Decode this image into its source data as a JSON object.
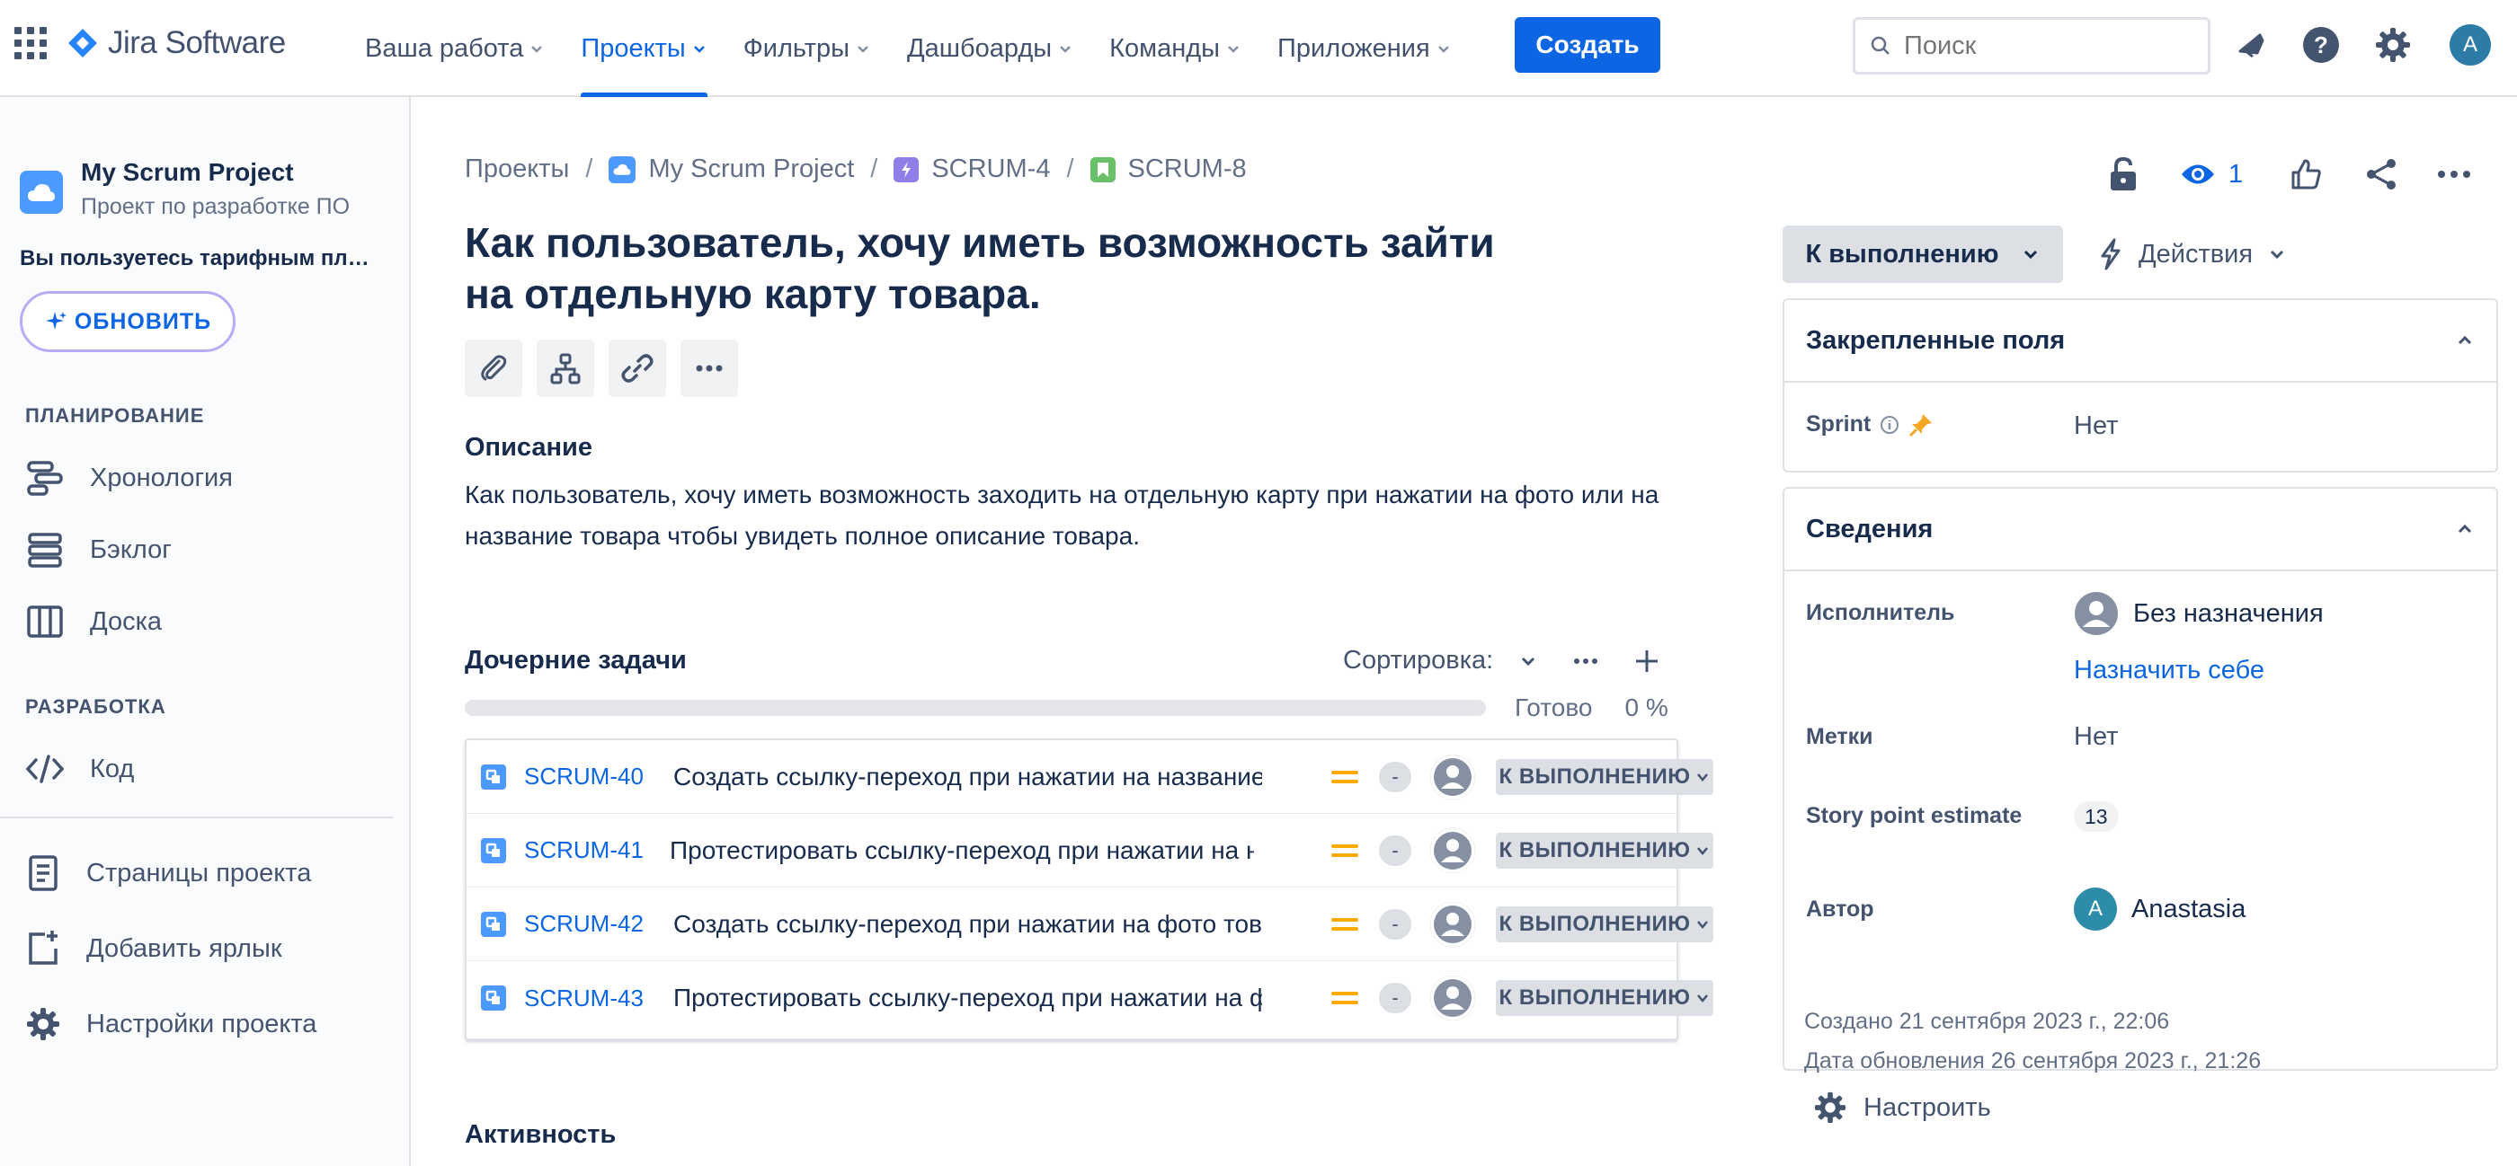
{
  "topbar": {
    "logo_text": "Jira Software",
    "nav": [
      {
        "label": "Ваша работа"
      },
      {
        "label": "Проекты"
      },
      {
        "label": "Фильтры"
      },
      {
        "label": "Дашбоарды"
      },
      {
        "label": "Команды"
      },
      {
        "label": "Приложения"
      }
    ],
    "create_label": "Создать",
    "search_placeholder": "Поиск",
    "avatar_initial": "A",
    "accent": "#0c66e4"
  },
  "sidebar": {
    "project_name": "My Scrum Project",
    "project_type": "Проект по разработке ПО",
    "plan_notice": "Вы пользуетесь тарифным планом Free",
    "upgrade_label": "ОБНОВИТЬ",
    "planning_header": "ПЛАНИРОВАНИЕ",
    "planning_items": [
      "Хронология",
      "Бэклог",
      "Доска"
    ],
    "dev_header": "РАЗРАБОТКА",
    "dev_items": [
      "Код"
    ],
    "footer_items": [
      "Страницы проекта",
      "Добавить ярлык",
      "Настройки проекта"
    ]
  },
  "breadcrumb": {
    "root": "Проекты",
    "project": "My Scrum Project",
    "epic": "SCRUM-4",
    "issue": "SCRUM-8",
    "sep": "/"
  },
  "issue": {
    "title": "Как пользователь, хочу иметь возможность зайти на отдельную карту товара.",
    "description_header": "Описание",
    "description": "Как пользователь, хочу иметь возможность заходить на отдельную карту при нажатии на фото или на название товара чтобы увидеть полное описание товара."
  },
  "child_issues": {
    "header": "Дочерние задачи",
    "sort_label": "Сортировка:",
    "done_label": "Готово",
    "done_percent": "0 %",
    "done_fraction": 0,
    "items": [
      {
        "key": "SCRUM-40",
        "summary": "Создать ссылку-переход при нажатии на название товара",
        "dash": "-",
        "status": "К ВЫПОЛНЕНИЮ"
      },
      {
        "key": "SCRUM-41",
        "summary": "Протестировать ссылку-переход при нажатии на название товара",
        "dash": "-",
        "status": "К ВЫПОЛНЕНИЮ"
      },
      {
        "key": "SCRUM-42",
        "summary": "Создать ссылку-переход при нажатии на фото товара",
        "dash": "-",
        "status": "К ВЫПОЛНЕНИЮ"
      },
      {
        "key": "SCRUM-43",
        "summary": "Протестировать ссылку-переход при нажатии на фото товара",
        "dash": "-",
        "status": "К ВЫПОЛНЕНИЮ"
      }
    ]
  },
  "activity_header": "Активность",
  "right_panel": {
    "watch_count": "1",
    "status_label": "К выполнению",
    "actions_label": "Действия",
    "pinned": {
      "header": "Закрепленные поля",
      "sprint_label": "Sprint",
      "sprint_value": "Нет"
    },
    "details": {
      "header": "Сведения",
      "assignee_label": "Исполнитель",
      "assignee_value": "Без назначения",
      "assign_self": "Назначить себе",
      "labels_label": "Метки",
      "labels_value": "Нет",
      "sp_label": "Story point estimate",
      "sp_value": "13",
      "reporter_label": "Автор",
      "reporter_value": "Anastasia",
      "reporter_initial": "A"
    },
    "created": "Создано 21 сентября 2023 г., 22:06",
    "updated": "Дата обновления 26 сентября 2023 г., 21:26",
    "configure_label": "Настроить"
  }
}
